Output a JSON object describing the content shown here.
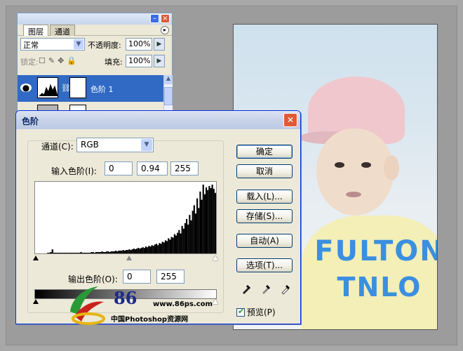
{
  "layers_panel": {
    "tabs": [
      "图层",
      "通道"
    ],
    "blend_mode": "正常",
    "opacity_label": "不透明度:",
    "opacity_value": "100%",
    "lock_label": "锁定:",
    "fill_label": "填充:",
    "fill_value": "100%",
    "layer_name": "色阶 1"
  },
  "dialog": {
    "title": "色阶",
    "channel_label": "通道(C):",
    "channel_value": "RGB",
    "input_label": "输入色阶(I):",
    "input_black": "0",
    "input_gamma": "0.94",
    "input_white": "255",
    "output_label": "输出色阶(O):",
    "output_black": "0",
    "output_white": "255",
    "buttons": {
      "ok": "确定",
      "cancel": "取消",
      "load": "载入(L)...",
      "save": "存储(S)...",
      "auto": "自动(A)",
      "options": "选项(T)..."
    },
    "preview_label": "预览(P)",
    "preview_checked": true
  },
  "histogram": {
    "type": "bar",
    "title": "",
    "xlim": [
      0,
      255
    ],
    "values": [
      0,
      0,
      0,
      0,
      0,
      0,
      0,
      0,
      1,
      1,
      2,
      6,
      1,
      1,
      1,
      1,
      1,
      1,
      1,
      1,
      1,
      1,
      1,
      1,
      1,
      1,
      1,
      1,
      1,
      1,
      2,
      1,
      1,
      1,
      1,
      1,
      1,
      2,
      2,
      1,
      2,
      2,
      2,
      2,
      3,
      2,
      2,
      3,
      3,
      2,
      3,
      3,
      3,
      4,
      3,
      4,
      4,
      4,
      5,
      4,
      5,
      5,
      6,
      5,
      6,
      7,
      6,
      7,
      8,
      7,
      8,
      9,
      8,
      10,
      9,
      11,
      10,
      12,
      11,
      13,
      14,
      12,
      15,
      14,
      17,
      16,
      19,
      18,
      22,
      20,
      24,
      23,
      28,
      26,
      30,
      34,
      29,
      40,
      36,
      44,
      50,
      42,
      56,
      48,
      62,
      70,
      58,
      80,
      66,
      90,
      78,
      100,
      86,
      96,
      92,
      98,
      95,
      100,
      94,
      88
    ]
  },
  "watermark": {
    "brand_number": "86",
    "url": "www.86ps.com",
    "site_name": "中国Photoshop资源网"
  },
  "photo": {
    "shirt_line1": "FULTON",
    "shirt_line2": "TNLO"
  }
}
